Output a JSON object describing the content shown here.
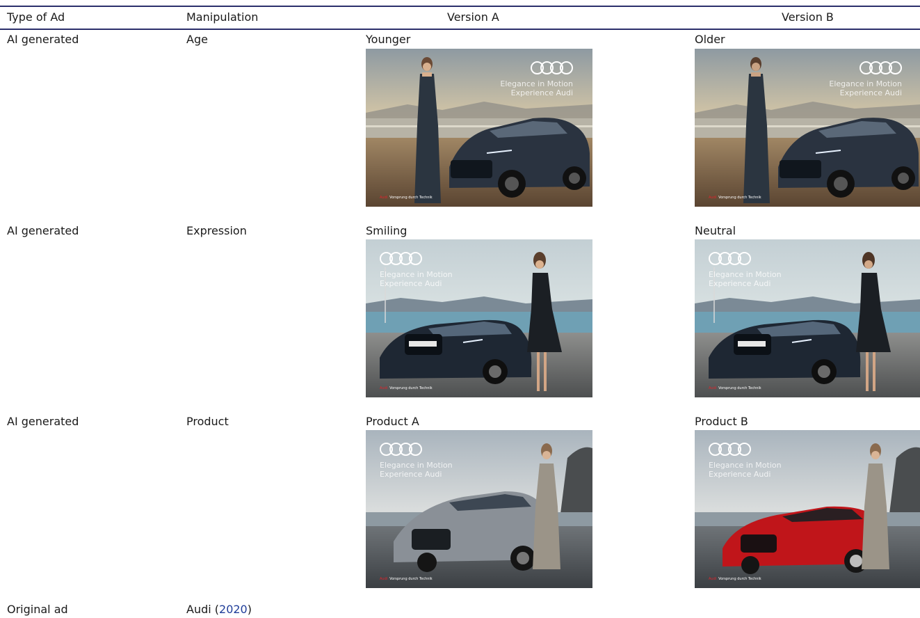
{
  "table": {
    "headers": {
      "type_of_ad": "Type of Ad",
      "manipulation": "Manipulation",
      "version_a": "Version A",
      "version_b": "Version B"
    },
    "rows": [
      {
        "type": "AI generated",
        "manipulation": "Age",
        "version_a_label": "Younger",
        "version_b_label": "Older"
      },
      {
        "type": "AI generated",
        "manipulation": "Expression",
        "version_a_label": "Smiling",
        "version_b_label": "Neutral"
      },
      {
        "type": "AI generated",
        "manipulation": "Product",
        "version_a_label": "Product A",
        "version_b_label": "Product B"
      }
    ],
    "footer": {
      "type": "Original ad",
      "source_name": "Audi (",
      "source_year": "2020",
      "source_close": ")"
    }
  },
  "ads": {
    "slogan_line1": "Elegance in Motion",
    "slogan_line2": "Experience Audi",
    "brand_word": "Audi",
    "tagline": "Vorsprung durch Technik",
    "plate": "N AS5516"
  },
  "colors": {
    "rule": "#2b2f6b",
    "link": "#1f3d99",
    "car_dark": "#2a3340",
    "car_silver": "#8a9097",
    "car_red": "#c0151a",
    "brand_red": "#e0242b"
  }
}
